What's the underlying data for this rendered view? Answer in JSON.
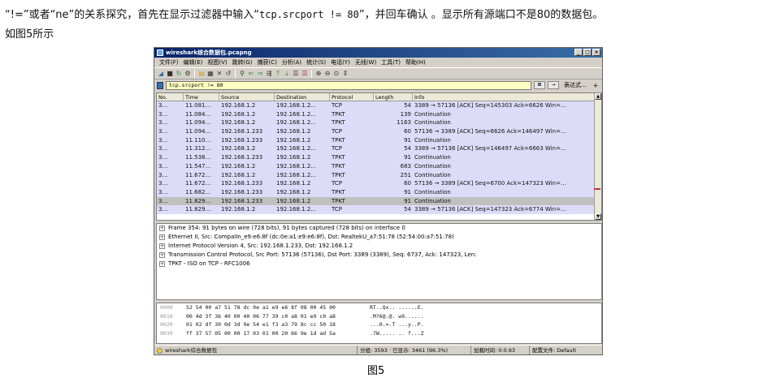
{
  "article": {
    "line1_a": "“!=”或者“ne”的关系探究，首先在显示过滤器中输入“",
    "line1_code": "tcp.srcport != 80",
    "line1_b": "”，并回车确认 。显示所有源端口不是80的数据包。",
    "line2": "如图5所示"
  },
  "window": {
    "title": "wireshark综合数据包.pcapng",
    "min": "_",
    "max": "□",
    "close": "×"
  },
  "menu": [
    "文件(F)",
    "编辑(E)",
    "视图(V)",
    "跳转(G)",
    "捕获(C)",
    "分析(A)",
    "统计(S)",
    "电话(Y)",
    "无线(W)",
    "工具(T)",
    "帮助(H)"
  ],
  "toolbar_icons": [
    "fin-icon",
    "stop-icon",
    "restart-icon",
    "options-icon",
    "open-icon",
    "save-icon",
    "close-file-icon",
    "reload-icon",
    "find-icon",
    "back-icon",
    "forward-icon",
    "goto-icon",
    "first-icon",
    "last-icon",
    "autoscroll-icon",
    "colorize-icon",
    "zoom-in-icon",
    "zoom-out-icon",
    "zoom-reset-icon",
    "resize-icon"
  ],
  "filter": {
    "value": "tcp.srcport != 80",
    "expression_label": "表达式…",
    "plus": "+"
  },
  "columns": [
    "No.",
    "Time",
    "Source",
    "Destination",
    "Protocol",
    "Length",
    "Info"
  ],
  "packets": [
    {
      "no": "3…",
      "time": "11.081…",
      "src": "192.168.1.2",
      "dst": "192.168.1.2…",
      "proto": "TCP",
      "len": "54",
      "info": "3389 → 57136 [ACK] Seq=145303 Ack=6626 Win=…"
    },
    {
      "no": "3…",
      "time": "11.084…",
      "src": "192.168.1.2",
      "dst": "192.168.1.2…",
      "proto": "TPKT",
      "len": "139",
      "info": "Continuation"
    },
    {
      "no": "3…",
      "time": "11.094…",
      "src": "192.168.1.2",
      "dst": "192.168.1.2…",
      "proto": "TPKT",
      "len": "1163",
      "info": "Continuation"
    },
    {
      "no": "3…",
      "time": "11.094…",
      "src": "192.168.1.233",
      "dst": "192.168.1.2",
      "proto": "TCP",
      "len": "60",
      "info": "57136 → 3389 [ACK] Seq=6626 Ack=146497 Win=…"
    },
    {
      "no": "3…",
      "time": "11.110…",
      "src": "192.168.1.233",
      "dst": "192.168.1.2",
      "proto": "TPKT",
      "len": "91",
      "info": "Continuation"
    },
    {
      "no": "3…",
      "time": "11.312…",
      "src": "192.168.1.2",
      "dst": "192.168.1.2…",
      "proto": "TCP",
      "len": "54",
      "info": "3389 → 57136 [ACK] Seq=146497 Ack=6663 Win=…"
    },
    {
      "no": "3…",
      "time": "11.538…",
      "src": "192.168.1.233",
      "dst": "192.168.1.2",
      "proto": "TPKT",
      "len": "91",
      "info": "Continuation"
    },
    {
      "no": "3…",
      "time": "11.547…",
      "src": "192.168.1.2",
      "dst": "192.168.1.2…",
      "proto": "TPKT",
      "len": "683",
      "info": "Continuation"
    },
    {
      "no": "3…",
      "time": "11.672…",
      "src": "192.168.1.2",
      "dst": "192.168.1.2…",
      "proto": "TPKT",
      "len": "251",
      "info": "Continuation"
    },
    {
      "no": "3…",
      "time": "11.672…",
      "src": "192.168.1.233",
      "dst": "192.168.1.2",
      "proto": "TCP",
      "len": "60",
      "info": "57136 → 3389 [ACK] Seq=6700 Ack=147323 Win=…"
    },
    {
      "no": "3…",
      "time": "11.682…",
      "src": "192.168.1.233",
      "dst": "192.168.1.2",
      "proto": "TPKT",
      "len": "91",
      "info": "Continuation"
    },
    {
      "no": "3…",
      "time": "11.829…",
      "src": "192.168.1.233",
      "dst": "192.168.1.2",
      "proto": "TPKT",
      "len": "91",
      "info": "Continuation"
    },
    {
      "no": "3…",
      "time": "11.829…",
      "src": "192.168.1.2",
      "dst": "192.168.1.2…",
      "proto": "TCP",
      "len": "54",
      "info": "3389 → 57136 [ACK] Seq=147323 Ack=6774 Win=…"
    }
  ],
  "selected_row": 11,
  "details": [
    "Frame 354: 91 bytes on wire (728 bits), 91 bytes captured (728 bits) on interface 0",
    "Ethernet II, Src: CompalIn_e9:e6:8f (dc:0e:a1:e9:e6:8f), Dst: RealtekU_a7:51:78 (52:54:00:a7:51:78)",
    "Internet Protocol Version 4, Src: 192.168.1.233, Dst: 192.168.1.2",
    "Transmission Control Protocol, Src Port: 57136 (57136), Dst Port: 3389 (3389), Seq: 6737, Ack: 147323, Len:",
    "TPKT - ISO on TCP - RFC1006"
  ],
  "hex": [
    {
      "off": "0000",
      "bytes": "52 54 00 a7 51 78 dc 0e  a1 e9 e6 8f 08 00 45 00",
      "ascii": "RT..Qx.. ......E."
    },
    {
      "off": "0010",
      "bytes": "00 4d 3f 36 40 00 40 06  77 39 c0 a8 01 e9 c0 a8",
      "ascii": ".M?6@.@. w9......"
    },
    {
      "off": "0020",
      "bytes": "01 02 df 30 0d 3d 9e 54  e1 f3 a3 79 8c cc 50 18",
      "ascii": "...0.=.T ...y..P."
    },
    {
      "off": "0030",
      "bytes": "ff 37 57 05 00 00 17 03  01 00 20 66 9e 1d ad 5a",
      "ascii": ".7W..... .. f...Z"
    }
  ],
  "status": {
    "file": "wireshark综合数据包",
    "packets": "分组: 3593 · 已显示: 3461 (96.3%)",
    "load": "加载时间: 0:0.93",
    "profile": "配置文件: Default"
  },
  "caption": "图5"
}
